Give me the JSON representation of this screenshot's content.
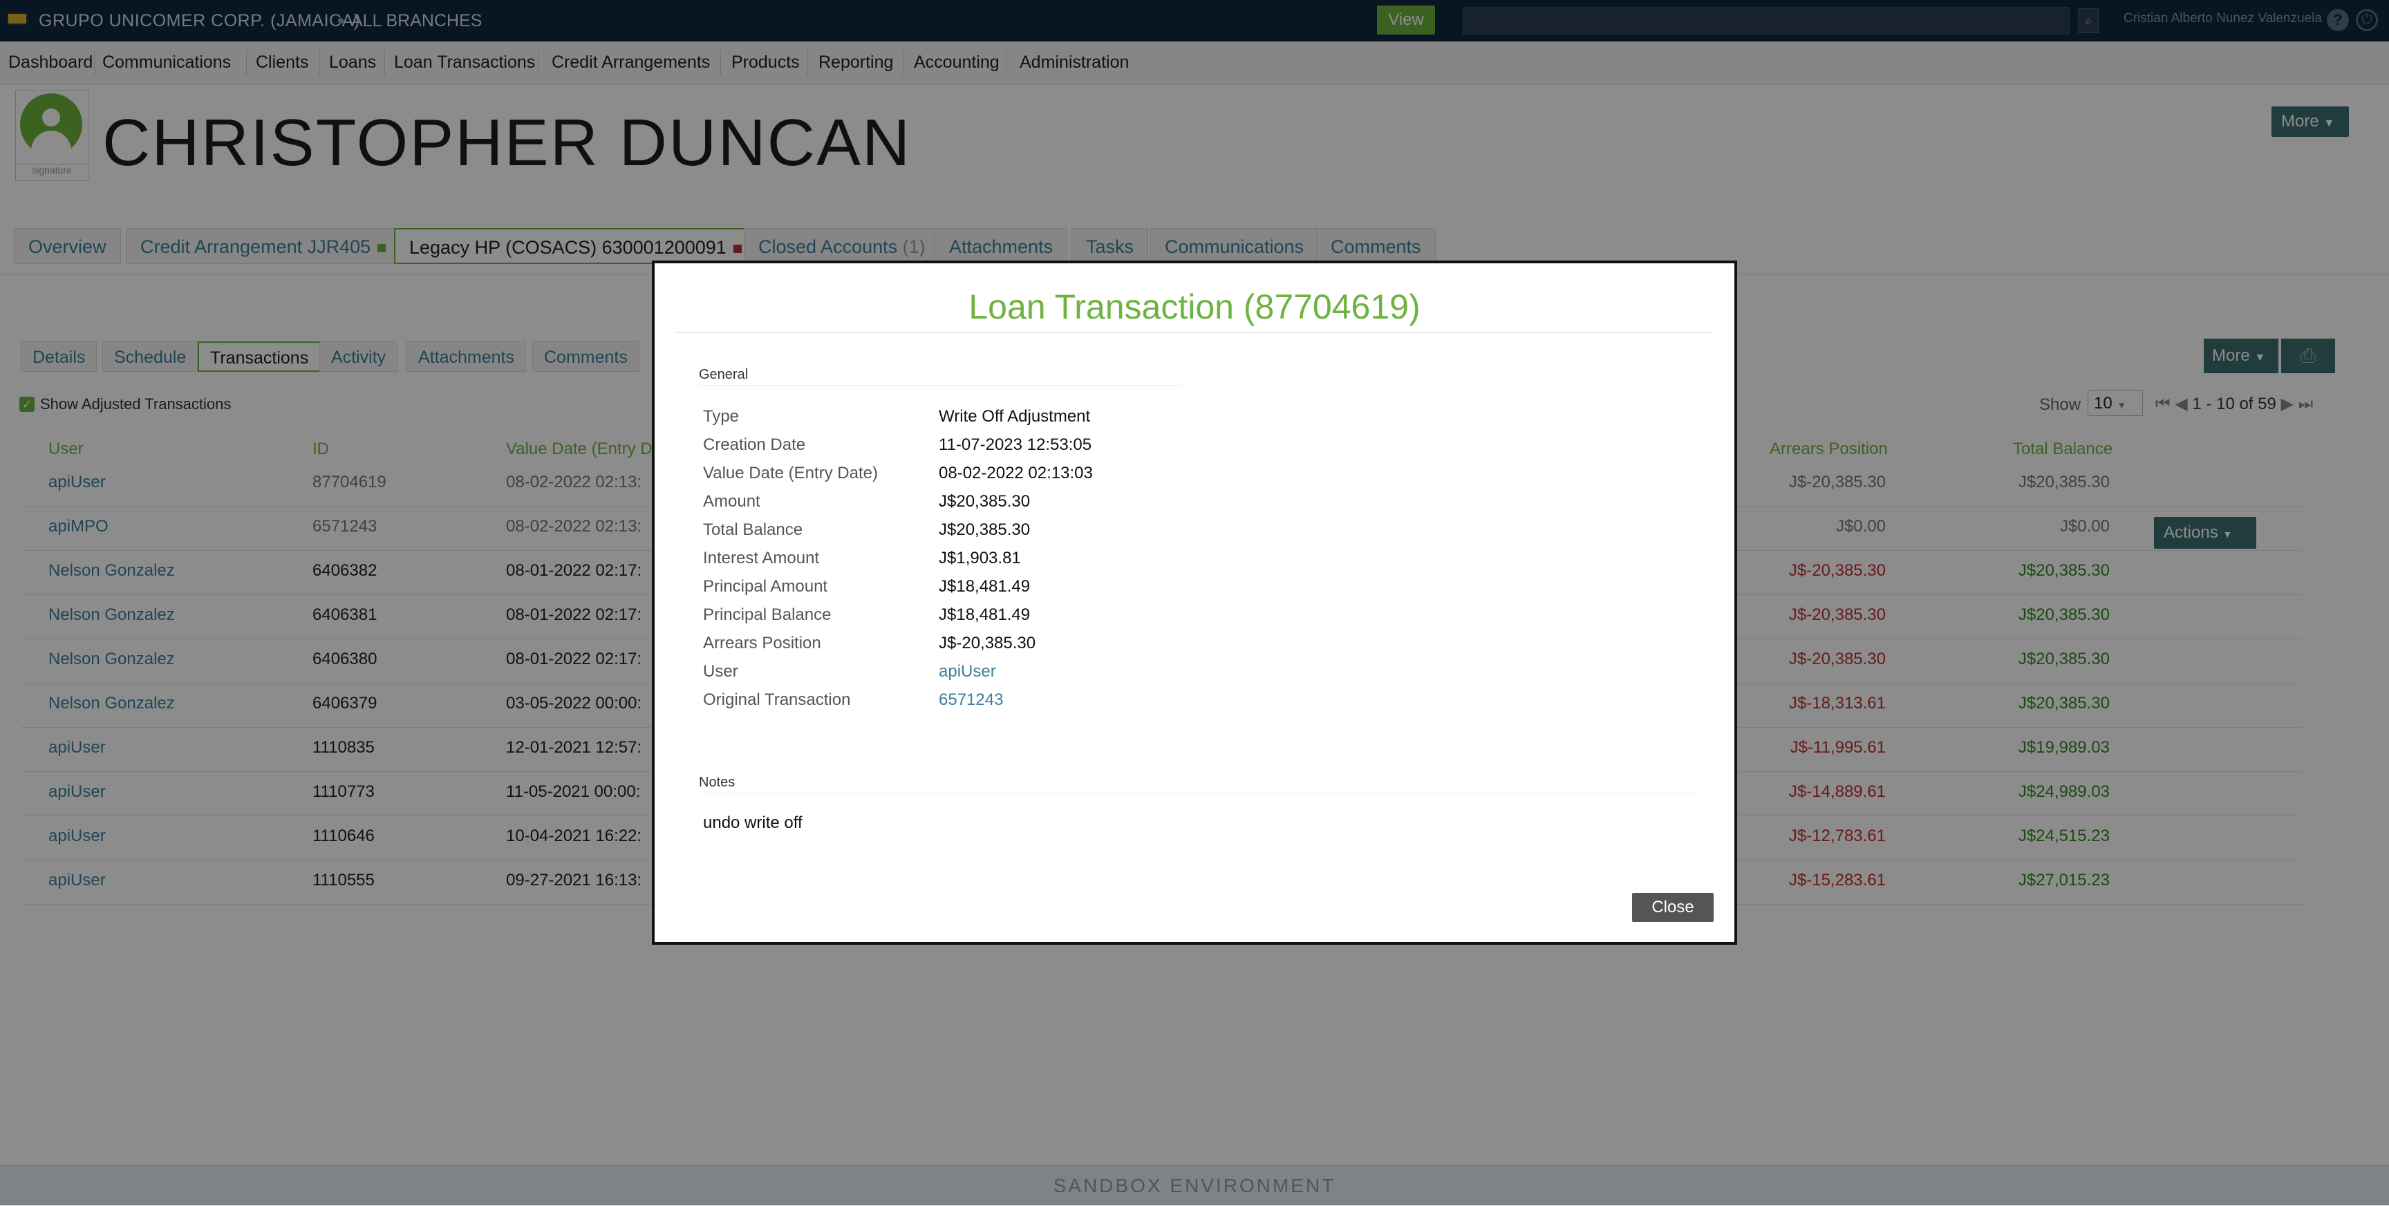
{
  "topbar": {
    "company": "GRUPO UNICOMER CORP. (JAMAICA)",
    "branches": "ALL BRANCHES",
    "view_label": "View",
    "search_placeholder": "",
    "user_name": "Cristian Alberto Nunez Valenzuela",
    "help": "?",
    "power": "⏻"
  },
  "nav": [
    "Dashboard",
    "Communications",
    "Clients",
    "Loans",
    "Loan Transactions",
    "Credit Arrangements",
    "Products",
    "Reporting",
    "Accounting",
    "Administration"
  ],
  "client": {
    "name": "CHRISTOPHER DUNCAN",
    "signature_label": "signature",
    "more_label": "More"
  },
  "account_tabs": {
    "overview": "Overview",
    "credit_arrangement": "Credit Arrangement JJR405",
    "legacy": "Legacy HP (COSACS) 630001200091",
    "closed_accounts": "Closed Accounts",
    "closed_count": "(1)",
    "attachments": "Attachments",
    "tasks": "Tasks",
    "communications": "Communications",
    "comments": "Comments"
  },
  "sub_tabs": [
    "Details",
    "Schedule",
    "Transactions",
    "Activity",
    "Attachments",
    "Comments"
  ],
  "toolbar": {
    "more_label": "More",
    "print_icon": "printer-icon",
    "show_adjusted": "Show Adjusted Transactions",
    "show_label": "Show",
    "page_size": "10",
    "pager_text": "1 - 10 of 59"
  },
  "table": {
    "headers": {
      "user": "User",
      "id": "ID",
      "value_date": "Value Date (Entry D",
      "arrears": "Arrears Position",
      "total": "Total Balance"
    },
    "actions_label": "Actions",
    "rows": [
      {
        "user": "apiUser",
        "id": "87704619",
        "date": "08-02-2022 02:13:",
        "arrears": "J$-20,385.30",
        "total": "J$20,385.30"
      },
      {
        "user": "apiMPO",
        "id": "6571243",
        "date": "08-02-2022 02:13:",
        "arrears": "J$0.00",
        "total": "J$0.00"
      },
      {
        "user": "Nelson Gonzalez",
        "id": "6406382",
        "date": "08-01-2022 02:17:",
        "arrears": "J$-20,385.30",
        "total": "J$20,385.30"
      },
      {
        "user": "Nelson Gonzalez",
        "id": "6406381",
        "date": "08-01-2022 02:17:",
        "arrears": "J$-20,385.30",
        "total": "J$20,385.30"
      },
      {
        "user": "Nelson Gonzalez",
        "id": "6406380",
        "date": "08-01-2022 02:17:",
        "arrears": "J$-20,385.30",
        "total": "J$20,385.30"
      },
      {
        "user": "Nelson Gonzalez",
        "id": "6406379",
        "date": "03-05-2022 00:00:",
        "arrears": "J$-18,313.61",
        "total": "J$20,385.30"
      },
      {
        "user": "apiUser",
        "id": "1110835",
        "date": "12-01-2021 12:57:",
        "arrears": "J$-11,995.61",
        "total": "J$19,989.03"
      },
      {
        "user": "apiUser",
        "id": "1110773",
        "date": "11-05-2021 00:00:",
        "arrears": "J$-14,889.61",
        "total": "J$24,989.03"
      },
      {
        "user": "apiUser",
        "id": "1110646",
        "date": "10-04-2021 16:22:",
        "arrears": "J$-12,783.61",
        "total": "J$24,515.23"
      },
      {
        "user": "apiUser",
        "id": "1110555",
        "date": "09-27-2021 16:13:",
        "arrears": "J$-15,283.61",
        "total": "J$27,015.23"
      }
    ]
  },
  "modal": {
    "title": "Loan Transaction (87704619)",
    "general_label": "General",
    "fields": [
      {
        "label": "Type",
        "value": "Write Off Adjustment"
      },
      {
        "label": "Creation Date",
        "value": "11-07-2023 12:53:05"
      },
      {
        "label": "Value Date (Entry Date)",
        "value": "08-02-2022 02:13:03"
      },
      {
        "label": "Amount",
        "value": "J$20,385.30"
      },
      {
        "label": "Total Balance",
        "value": "J$20,385.30"
      },
      {
        "label": "Interest Amount",
        "value": "J$1,903.81"
      },
      {
        "label": "Principal Amount",
        "value": "J$18,481.49"
      },
      {
        "label": "Principal Balance",
        "value": "J$18,481.49"
      },
      {
        "label": "Arrears Position",
        "value": "J$-20,385.30"
      },
      {
        "label": "User",
        "value": "apiUser"
      },
      {
        "label": "Original Transaction",
        "value": "6571243"
      }
    ],
    "notes_label": "Notes",
    "notes_text": "undo write off",
    "close_label": "Close"
  },
  "footer": {
    "text": "SANDBOX ENVIRONMENT"
  },
  "colors": {
    "accent_green": "#6db33f",
    "topbar": "#0f2740",
    "link": "#3d7f9a",
    "negative": "#c0302e"
  }
}
